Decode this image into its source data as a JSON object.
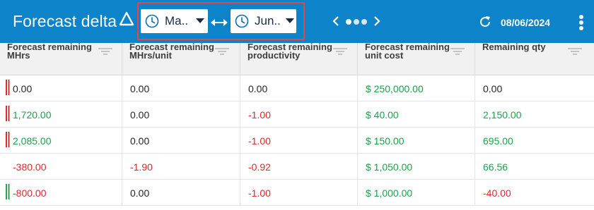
{
  "header": {
    "title": "Forecast delta",
    "from_period": "Ma..",
    "to_period": "Jun..",
    "date": "08/06/2024"
  },
  "columns": [
    "Forecast remaining MHrs",
    "Forecast remaining MHrs/unit",
    "Forecast remaining productivity",
    "Forecast remaining unit cost",
    "Remaining qty"
  ],
  "rows": [
    {
      "marker": "red-bars",
      "cells": [
        {
          "text": "0.00",
          "tone": "neu"
        },
        {
          "text": "0.00",
          "tone": "neu"
        },
        {
          "text": "0.00",
          "tone": "neu"
        },
        {
          "text": "$ 250,000.00",
          "tone": "pos"
        },
        {
          "text": "0.00",
          "tone": "neu"
        }
      ]
    },
    {
      "marker": "red-bars",
      "cells": [
        {
          "text": "1,720.00",
          "tone": "pos"
        },
        {
          "text": "0.00",
          "tone": "neu"
        },
        {
          "text": "-1.00",
          "tone": "neg"
        },
        {
          "text": "$ 40.00",
          "tone": "pos"
        },
        {
          "text": "2,150.00",
          "tone": "pos"
        }
      ]
    },
    {
      "marker": "red-bars",
      "cells": [
        {
          "text": "2,085.00",
          "tone": "pos"
        },
        {
          "text": "0.00",
          "tone": "neu"
        },
        {
          "text": "-1.00",
          "tone": "neg"
        },
        {
          "text": "$ 150.00",
          "tone": "pos"
        },
        {
          "text": "695.00",
          "tone": "pos"
        }
      ]
    },
    {
      "marker": "none",
      "cells": [
        {
          "text": "-380.00",
          "tone": "neg"
        },
        {
          "text": "-1.90",
          "tone": "neg"
        },
        {
          "text": "-0.92",
          "tone": "neg"
        },
        {
          "text": "$ 1,050.00",
          "tone": "pos"
        },
        {
          "text": "66.56",
          "tone": "pos"
        }
      ]
    },
    {
      "marker": "green-bars",
      "cells": [
        {
          "text": "-800.00",
          "tone": "neg"
        },
        {
          "text": "0.00",
          "tone": "neu"
        },
        {
          "text": "-1.00",
          "tone": "neg"
        },
        {
          "text": "$ 1,000.00",
          "tone": "pos"
        },
        {
          "text": "-40.00",
          "tone": "neg"
        }
      ]
    }
  ],
  "colors": {
    "topbar": "#0d83c9",
    "positive": "#1aa34a",
    "negative": "#e0272d",
    "highlight": "#e0484a"
  },
  "icons": [
    "delta-icon",
    "clock-icon",
    "caret-down-icon",
    "swap-arrows-icon",
    "chevron-left-icon",
    "pager-dots-icon",
    "chevron-right-icon",
    "refresh-icon",
    "kebab-menu-icon",
    "filter-icon"
  ]
}
